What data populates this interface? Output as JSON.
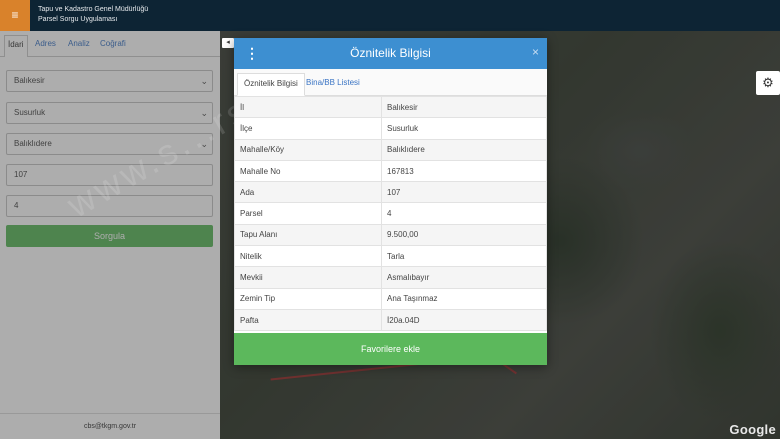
{
  "header": {
    "menu_icon": "hamburger-icon",
    "title_line1": "Tapu ve Kadastro Genel Müdürlüğü",
    "title_line2": "Parsel Sorgu Uygulaması"
  },
  "left_panel": {
    "tabs": [
      {
        "label": "İdari",
        "active": true
      },
      {
        "label": "Adres",
        "active": false
      },
      {
        "label": "Analiz",
        "active": false
      },
      {
        "label": "Coğrafi",
        "active": false
      }
    ],
    "selects": [
      {
        "value": "Balıkesir"
      },
      {
        "value": "Susurluk"
      },
      {
        "value": "Balıklıdere"
      }
    ],
    "inputs": [
      {
        "value": "107"
      },
      {
        "value": "4"
      }
    ],
    "query_button": "Sorgula",
    "footer_email": "cbs@tkgm.gov.tr"
  },
  "modal": {
    "title": "Öznitelik Bilgisi",
    "close": "×",
    "tabs": [
      {
        "label": "Öznitelik Bilgisi",
        "active": true
      },
      {
        "label": "Bina/BB Listesi",
        "active": false
      }
    ],
    "rows": [
      {
        "key": "İl",
        "value": "Balıkesir"
      },
      {
        "key": "İlçe",
        "value": "Susurluk"
      },
      {
        "key": "Mahalle/Köy",
        "value": "Balıklıdere"
      },
      {
        "key": "Mahalle No",
        "value": "167813"
      },
      {
        "key": "Ada",
        "value": "107"
      },
      {
        "key": "Parsel",
        "value": "4"
      },
      {
        "key": "Tapu Alanı",
        "value": "9.500,00"
      },
      {
        "key": "Nitelik",
        "value": "Tarla"
      },
      {
        "key": "Mevkii",
        "value": "Asmalıbayır"
      },
      {
        "key": "Zemin Tip",
        "value": "Ana Taşınmaz"
      },
      {
        "key": "Pafta",
        "value": "İ20a.04D"
      }
    ],
    "favorite_button": "Favorilere ekle"
  },
  "map": {
    "settings_icon": "gear-icon",
    "attribution": "Google"
  },
  "watermark": "www.s...rsi.com"
}
